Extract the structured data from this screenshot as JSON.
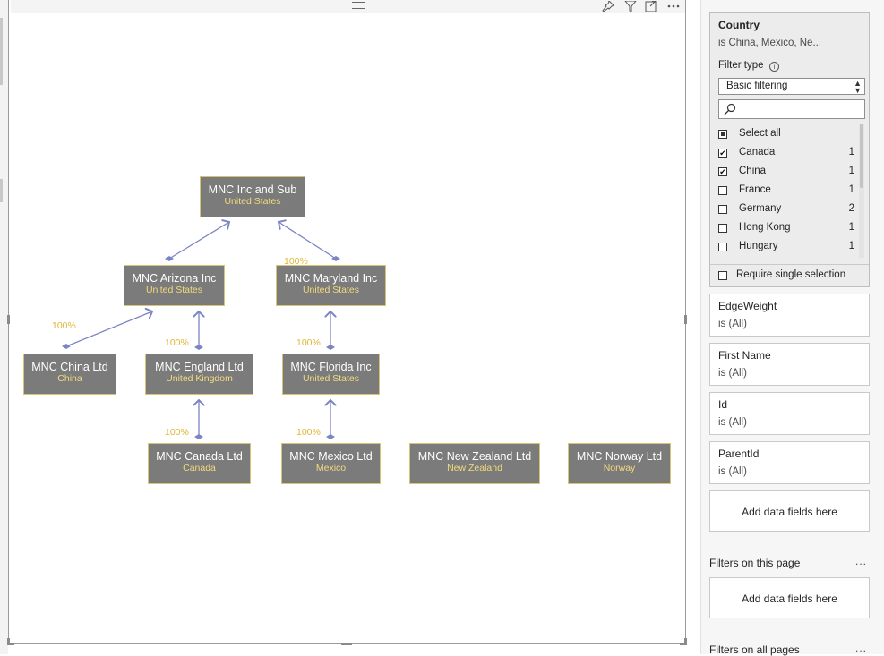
{
  "visual_header": {
    "icons": [
      "pin-icon",
      "filter-icon",
      "focus-mode-icon",
      "more-options-icon"
    ]
  },
  "org_chart": {
    "nodes": [
      {
        "id": "root",
        "name": "MNC Inc and Sub",
        "country": "United States"
      },
      {
        "id": "arizona",
        "name": "MNC Arizona Inc",
        "country": "United States"
      },
      {
        "id": "maryland",
        "name": "MNC Maryland Inc",
        "country": "United States"
      },
      {
        "id": "china",
        "name": "MNC China Ltd",
        "country": "China"
      },
      {
        "id": "england",
        "name": "MNC England Ltd",
        "country": "United Kingdom"
      },
      {
        "id": "florida",
        "name": "MNC Florida Inc",
        "country": "United States"
      },
      {
        "id": "canada",
        "name": "MNC Canada Ltd",
        "country": "Canada"
      },
      {
        "id": "mexico",
        "name": "MNC Mexico Ltd",
        "country": "Mexico"
      },
      {
        "id": "newzealand",
        "name": "MNC New Zealand Ltd",
        "country": "New Zealand"
      },
      {
        "id": "norway",
        "name": "MNC Norway Ltd",
        "country": "Norway"
      }
    ],
    "edges": [
      {
        "from": "root",
        "to": "arizona",
        "weight": ""
      },
      {
        "from": "root",
        "to": "maryland",
        "weight": "100%"
      },
      {
        "from": "arizona",
        "to": "china",
        "weight": "100%"
      },
      {
        "from": "arizona",
        "to": "england",
        "weight": "100%"
      },
      {
        "from": "maryland",
        "to": "florida",
        "weight": "100%"
      },
      {
        "from": "england",
        "to": "canada",
        "weight": "100%"
      },
      {
        "from": "florida",
        "to": "mexico",
        "weight": "100%"
      }
    ]
  },
  "filter_pane": {
    "country_card": {
      "title": "Country",
      "summary": "is China, Mexico, Ne...",
      "filter_type_label": "Filter type",
      "filter_type_value": "Basic filtering",
      "search_placeholder": "",
      "select_all_label": "Select all",
      "items": [
        {
          "label": "Canada",
          "count": "1",
          "checked": true
        },
        {
          "label": "China",
          "count": "1",
          "checked": true
        },
        {
          "label": "France",
          "count": "1",
          "checked": false
        },
        {
          "label": "Germany",
          "count": "2",
          "checked": false
        },
        {
          "label": "Hong Kong",
          "count": "1",
          "checked": false
        },
        {
          "label": "Hungary",
          "count": "1",
          "checked": false
        }
      ],
      "require_single_label": "Require single selection"
    },
    "cards": [
      {
        "title": "EdgeWeight",
        "summary": "is (All)"
      },
      {
        "title": "First Name",
        "summary": "is (All)"
      },
      {
        "title": "Id",
        "summary": "is (All)"
      },
      {
        "title": "ParentId",
        "summary": "is (All)"
      }
    ],
    "add_fields_label": "Add data fields here",
    "page_section_label": "Filters on this page",
    "page_add_fields_label": "Add data fields here",
    "all_pages_section_label": "Filters on all pages",
    "more_label": "..."
  },
  "colors": {
    "node_fill": "#7b7b7b",
    "node_border": "#d7c474",
    "node_country": "#f2da7c",
    "edge": "#7b84c4",
    "weight_label": "#e0b635"
  }
}
